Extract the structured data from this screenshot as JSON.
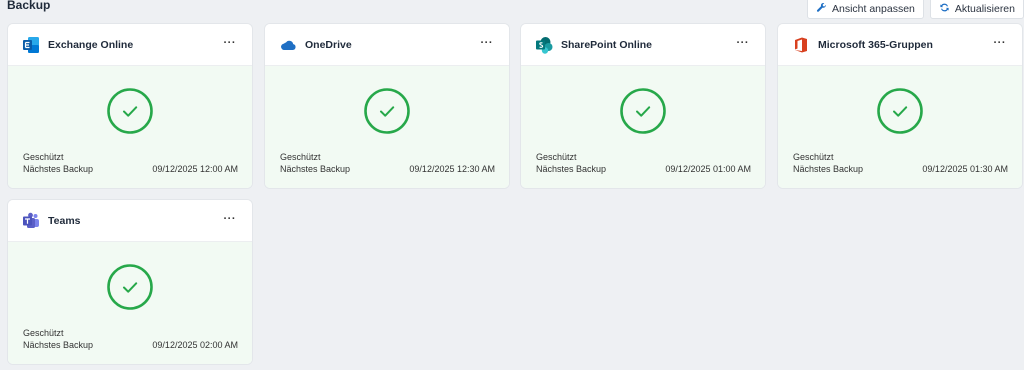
{
  "header": {
    "title": "Backup",
    "customize_label": "Ansicht anpassen",
    "refresh_label": "Aktualisieren"
  },
  "colors": {
    "success": "#27a84a",
    "exchange": "#1f6fc4",
    "onedrive": "#1f6fc4",
    "sharepoint": "#0b7a77",
    "m365": "#d8401f",
    "teams": "#5b5fc7"
  },
  "cards": [
    {
      "title": "Exchange Online",
      "icon": "exchange-icon",
      "status": "Geschützt",
      "next_label": "Nächstes Backup",
      "next_value": "09/12/2025 12:00 AM",
      "more": "···"
    },
    {
      "title": "OneDrive",
      "icon": "onedrive-icon",
      "status": "Geschützt",
      "next_label": "Nächstes Backup",
      "next_value": "09/12/2025 12:30 AM",
      "more": "···"
    },
    {
      "title": "SharePoint Online",
      "icon": "sharepoint-icon",
      "status": "Geschützt",
      "next_label": "Nächstes Backup",
      "next_value": "09/12/2025 01:00 AM",
      "more": "···"
    },
    {
      "title": "Microsoft 365-Gruppen",
      "icon": "m365-groups-icon",
      "status": "Geschützt",
      "next_label": "Nächstes Backup",
      "next_value": "09/12/2025 01:30 AM",
      "more": "···"
    },
    {
      "title": "Teams",
      "icon": "teams-icon",
      "status": "Geschützt",
      "next_label": "Nächstes Backup",
      "next_value": "09/12/2025 02:00 AM",
      "more": "···"
    }
  ]
}
